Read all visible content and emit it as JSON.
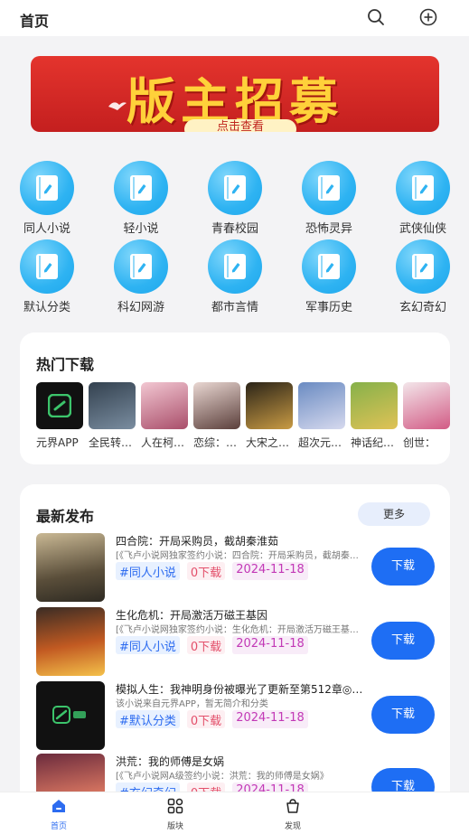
{
  "header": {
    "title": "首页",
    "search_icon": "search-icon",
    "add_icon": "plus-circle-icon"
  },
  "banner": {
    "text": "版主招募",
    "sub": "点击查看"
  },
  "categories": [
    {
      "label": "同人小说"
    },
    {
      "label": "轻小说"
    },
    {
      "label": "青春校园"
    },
    {
      "label": "恐怖灵异"
    },
    {
      "label": "武侠仙侠"
    },
    {
      "label": "默认分类"
    },
    {
      "label": "科幻网游"
    },
    {
      "label": "都市言情"
    },
    {
      "label": "军事历史"
    },
    {
      "label": "玄幻奇幻"
    }
  ],
  "hot": {
    "title": "热门下载",
    "items": [
      {
        "name": "元界APP"
      },
      {
        "name": "全民转…"
      },
      {
        "name": "人在柯…"
      },
      {
        "name": "恋综：…"
      },
      {
        "name": "大宋之…"
      },
      {
        "name": "超次元…"
      },
      {
        "name": "神话纪…"
      },
      {
        "name": "创世："
      }
    ]
  },
  "latest": {
    "title": "最新发布",
    "more": "更多",
    "books": [
      {
        "title": "四合院：开局采购员，截胡秦淮茹",
        "desc": "[《飞卢小说网独家签约小说：四合院：开局采购员，截胡秦淮茹》",
        "category": "#同人小说",
        "downloads": "0下载",
        "date": "2024-11-18",
        "button": "下载"
      },
      {
        "title": "生化危机：开局激活万磁王基因",
        "desc": "[《飞卢小说网独家签约小说：生化危机：开局激活万磁王基因》",
        "category": "#同人小说",
        "downloads": "0下载",
        "date": "2024-11-18",
        "button": "下载"
      },
      {
        "title": "模拟人生：我神明身份被曝光了更新至第512章◎…",
        "desc": "该小说来自元界APP，暂无简介和分类",
        "category": "#默认分类",
        "downloads": "0下载",
        "date": "2024-11-18",
        "button": "下载"
      },
      {
        "title": "洪荒：我的师傅是女娲",
        "desc": "[《飞卢小说网A级签约小说：洪荒：我的师傅是女娲》",
        "category": "#玄幻奇幻",
        "downloads": "0下载",
        "date": "2024-11-18",
        "button": "下载"
      }
    ]
  },
  "nav": [
    {
      "label": "首页",
      "icon": "home-icon"
    },
    {
      "label": "版块",
      "icon": "grid-icon"
    },
    {
      "label": "发现",
      "icon": "discover-icon"
    }
  ],
  "colors": {
    "accent": "#1e6ef4",
    "category_circle": "#2eb3f2",
    "banner_red": "#d8281f",
    "banner_gold": "#ffd13a"
  }
}
